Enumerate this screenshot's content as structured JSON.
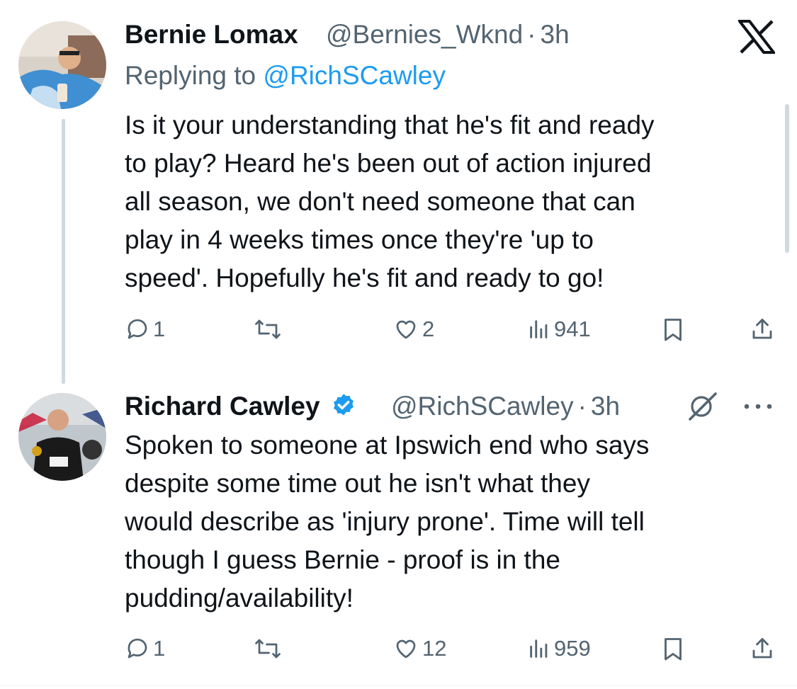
{
  "close_label": "X",
  "tweets": [
    {
      "name": "Bernie Lomax",
      "handle": "@Bernies_Wknd",
      "separator": "·",
      "time": "3h",
      "replying_prefix": "Replying to",
      "replying_to": "@RichSCawley",
      "text": "Is it your understanding that he's fit and ready\nto play? Heard he's been out of action injured\nall season, we don't need someone that can\nplay in 4 weeks times once they're 'up to\nspeed'. Hopefully he's fit and ready to go!",
      "replies": "1",
      "likes": "2",
      "views": "941"
    },
    {
      "name": "Richard Cawley",
      "verified": true,
      "handle": "@RichSCawley",
      "separator": "·",
      "time": "3h",
      "text": "Spoken to someone at Ipswich end who says\ndespite some time out he isn't what they\nwould describe as 'injury prone'. Time will tell\nthough I guess Bernie - proof is in the\npudding/availability!",
      "replies": "1",
      "likes": "12",
      "views": "959"
    }
  ],
  "colors": {
    "text": "#0f1419",
    "secondary": "#536471",
    "link": "#1d9bf0",
    "thread_line": "#cfd9de"
  }
}
